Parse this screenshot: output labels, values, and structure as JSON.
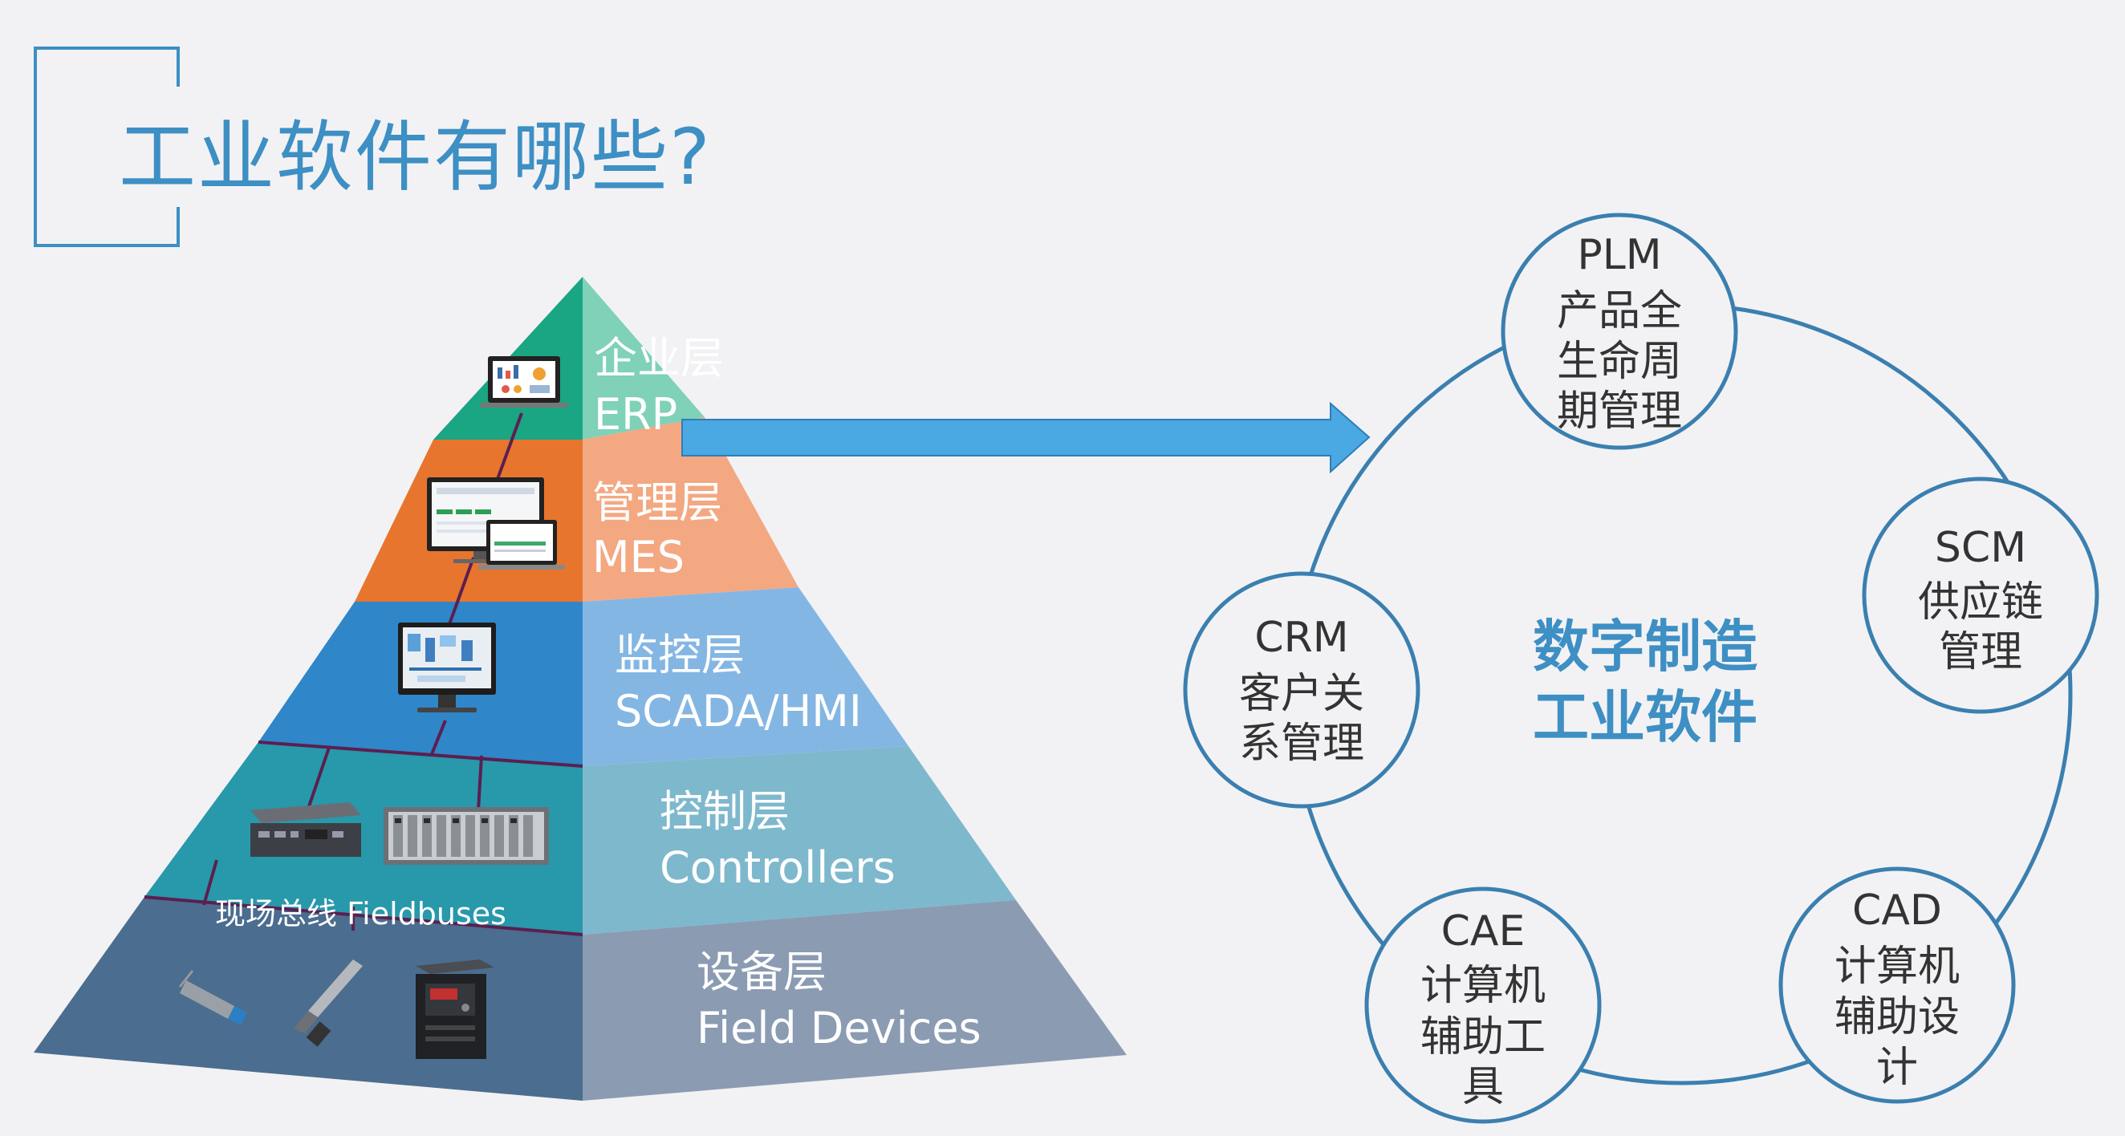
{
  "title": "工业软件有哪些?",
  "pyramid": {
    "layers": [
      {
        "name": "企业层",
        "sub": "ERP"
      },
      {
        "name": "管理层",
        "sub": "MES"
      },
      {
        "name": "监控层",
        "sub": "SCADA/HMI"
      },
      {
        "name": "控制层",
        "sub": "Controllers"
      },
      {
        "name": "设备层",
        "sub": "Field Devices"
      }
    ],
    "fieldbus_label": "现场总线 Fieldbuses"
  },
  "wheel": {
    "center_line1": "数字制造",
    "center_line2": "工业软件",
    "nodes": [
      {
        "abbr": "PLM",
        "lines": [
          "产品全",
          "生命周",
          "期管理"
        ]
      },
      {
        "abbr": "SCM",
        "lines": [
          "供应链",
          "管理"
        ]
      },
      {
        "abbr": "CAD",
        "lines": [
          "计算机",
          "辅助设",
          "计"
        ]
      },
      {
        "abbr": "CAE",
        "lines": [
          "计算机",
          "辅助工",
          "具"
        ]
      },
      {
        "abbr": "CRM",
        "lines": [
          "客户关",
          "系管理"
        ]
      }
    ]
  },
  "colors": {
    "accent": "#3d8fc4",
    "arrow": "#4aa8e2",
    "center_text": "#3d8fc4"
  }
}
